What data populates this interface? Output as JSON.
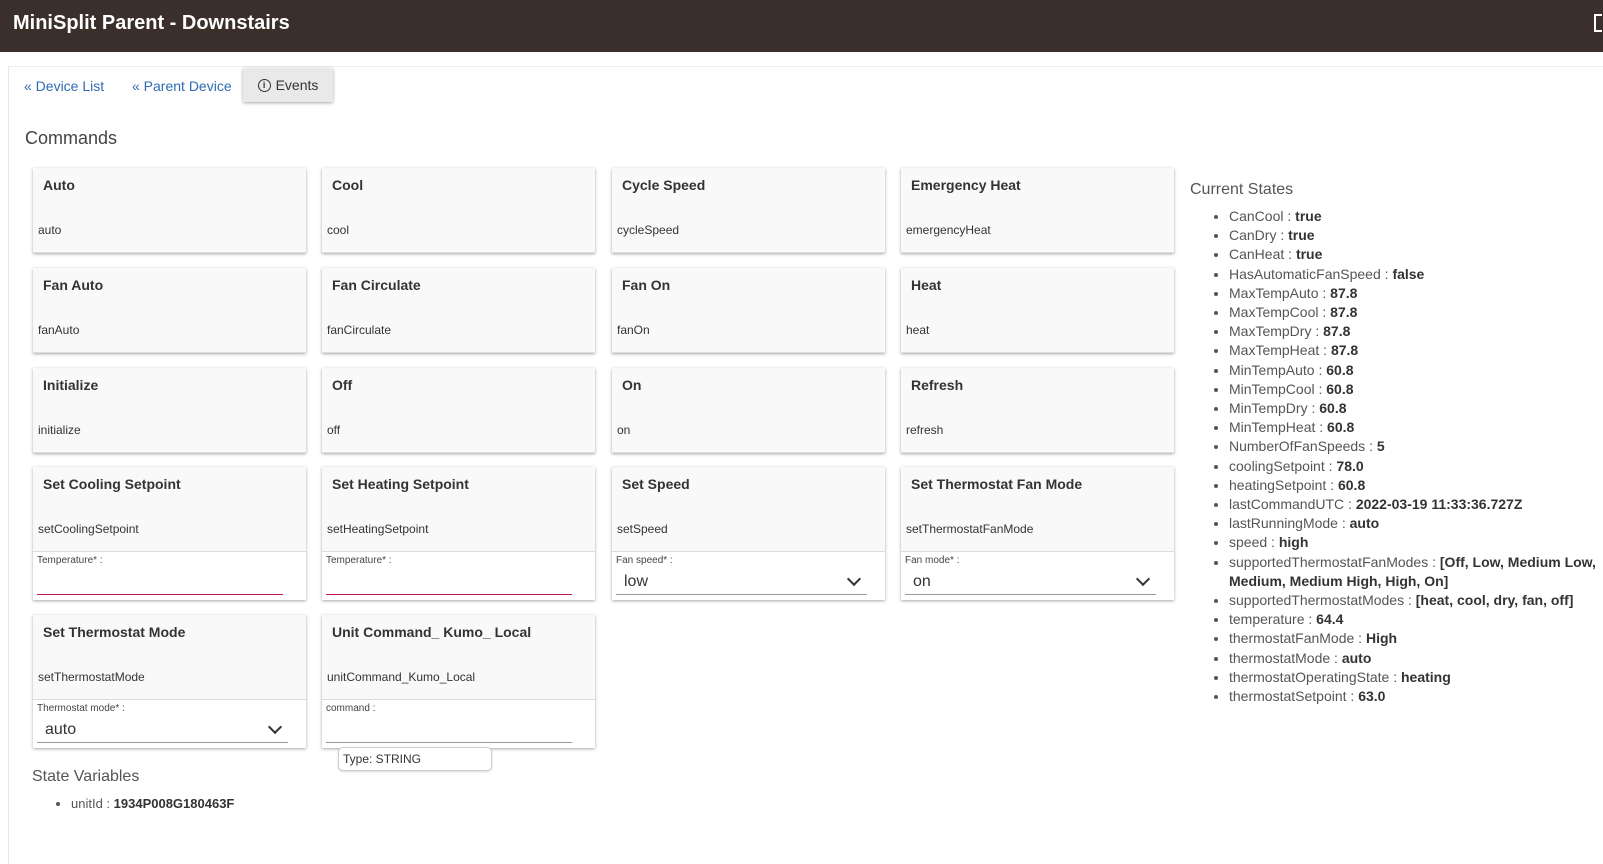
{
  "app": {
    "title": "MiniSplit Parent - Downstairs"
  },
  "nav": {
    "device_list": "« Device List",
    "parent_device": "« Parent Device",
    "events": "Events"
  },
  "commands_title": "Commands",
  "commands": [
    {
      "label": "Auto",
      "cmd": "auto"
    },
    {
      "label": "Cool",
      "cmd": "cool"
    },
    {
      "label": "Cycle Speed",
      "cmd": "cycleSpeed"
    },
    {
      "label": "Emergency Heat",
      "cmd": "emergencyHeat"
    },
    {
      "label": "Fan Auto",
      "cmd": "fanAuto"
    },
    {
      "label": "Fan Circulate",
      "cmd": "fanCirculate"
    },
    {
      "label": "Fan On",
      "cmd": "fanOn"
    },
    {
      "label": "Heat",
      "cmd": "heat"
    },
    {
      "label": "Initialize",
      "cmd": "initialize"
    },
    {
      "label": "Off",
      "cmd": "off"
    },
    {
      "label": "On",
      "cmd": "on"
    },
    {
      "label": "Refresh",
      "cmd": "refresh"
    },
    {
      "label": "Set Cooling Setpoint",
      "cmd": "setCoolingSetpoint",
      "param_label": "Temperature* :",
      "param_value": ""
    },
    {
      "label": "Set Heating Setpoint",
      "cmd": "setHeatingSetpoint",
      "param_label": "Temperature* :",
      "param_value": ""
    },
    {
      "label": "Set Speed",
      "cmd": "setSpeed",
      "param_label": "Fan speed* :",
      "param_value": "low"
    },
    {
      "label": "Set Thermostat Fan Mode",
      "cmd": "setThermostatFanMode",
      "param_label": "Fan mode* :",
      "param_value": "on"
    },
    {
      "label": "Set Thermostat Mode",
      "cmd": "setThermostatMode",
      "param_label": "Thermostat mode* :",
      "param_value": "auto"
    },
    {
      "label": "Unit Command_ Kumo_ Local",
      "cmd": "unitCommand_Kumo_Local",
      "param_label": "command :",
      "param_value": ""
    }
  ],
  "tooltip": "Type: STRING",
  "state_variables": {
    "title": "State Variables",
    "items": [
      {
        "key": "unitId",
        "value": "1934P008G180463F"
      }
    ]
  },
  "current_states": {
    "title": "Current States",
    "items": [
      {
        "key": "CanCool",
        "value": "true"
      },
      {
        "key": "CanDry",
        "value": "true"
      },
      {
        "key": "CanHeat",
        "value": "true"
      },
      {
        "key": "HasAutomaticFanSpeed",
        "value": "false"
      },
      {
        "key": "MaxTempAuto",
        "value": "87.8"
      },
      {
        "key": "MaxTempCool",
        "value": "87.8"
      },
      {
        "key": "MaxTempDry",
        "value": "87.8"
      },
      {
        "key": "MaxTempHeat",
        "value": "87.8"
      },
      {
        "key": "MinTempAuto",
        "value": "60.8"
      },
      {
        "key": "MinTempCool",
        "value": "60.8"
      },
      {
        "key": "MinTempDry",
        "value": "60.8"
      },
      {
        "key": "MinTempHeat",
        "value": "60.8"
      },
      {
        "key": "NumberOfFanSpeeds",
        "value": "5"
      },
      {
        "key": "coolingSetpoint",
        "value": "78.0"
      },
      {
        "key": "heatingSetpoint",
        "value": "60.8"
      },
      {
        "key": "lastCommandUTC",
        "value": "2022-03-19 11:33:36.727Z"
      },
      {
        "key": "lastRunningMode",
        "value": "auto"
      },
      {
        "key": "speed",
        "value": "high"
      },
      {
        "key": "supportedThermostatFanModes",
        "value": "[Off, Low, Medium Low, Medium, Medium High, High, On]"
      },
      {
        "key": "supportedThermostatModes",
        "value": "[heat, cool, dry, fan, off]"
      },
      {
        "key": "temperature",
        "value": "64.4"
      },
      {
        "key": "thermostatFanMode",
        "value": "High"
      },
      {
        "key": "thermostatMode",
        "value": "auto"
      },
      {
        "key": "thermostatOperatingState",
        "value": "heating"
      },
      {
        "key": "thermostatSetpoint",
        "value": "63.0"
      }
    ]
  }
}
